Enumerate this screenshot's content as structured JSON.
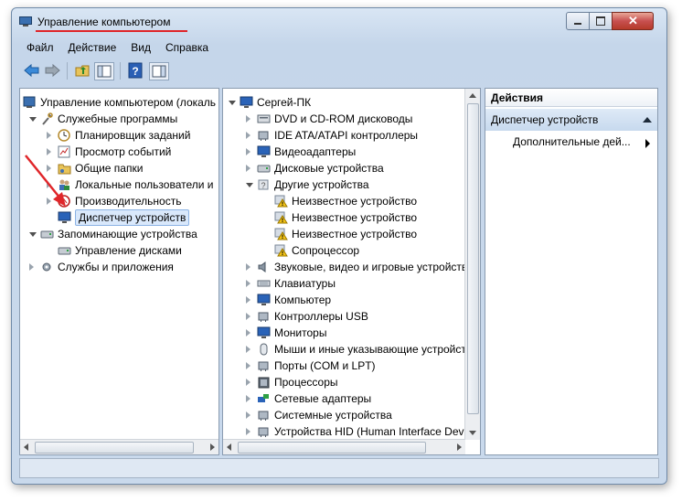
{
  "window": {
    "title": "Управление компьютером"
  },
  "menu": [
    "Файл",
    "Действие",
    "Вид",
    "Справка"
  ],
  "left_tree": [
    {
      "label": "Управление компьютером (локаль",
      "indent": 0,
      "expander": "none",
      "icon": "computer-management-icon"
    },
    {
      "label": "Служебные программы",
      "indent": 1,
      "expander": "down",
      "icon": "tools-icon"
    },
    {
      "label": "Планировщик заданий",
      "indent": 2,
      "expander": "right",
      "icon": "clock-icon"
    },
    {
      "label": "Просмотр событий",
      "indent": 2,
      "expander": "right",
      "icon": "event-viewer-icon"
    },
    {
      "label": "Общие папки",
      "indent": 2,
      "expander": "right",
      "icon": "shared-folder-icon"
    },
    {
      "label": "Локальные пользователи и",
      "indent": 2,
      "expander": "right",
      "icon": "users-icon"
    },
    {
      "label": "Производительность",
      "indent": 2,
      "expander": "right",
      "icon": "performance-icon"
    },
    {
      "label": "Диспетчер устройств",
      "indent": 2,
      "expander": "none",
      "icon": "device-manager-icon",
      "selected": true
    },
    {
      "label": "Запоминающие устройства",
      "indent": 1,
      "expander": "down",
      "icon": "storage-icon"
    },
    {
      "label": "Управление дисками",
      "indent": 2,
      "expander": "none",
      "icon": "disk-icon"
    },
    {
      "label": "Службы и приложения",
      "indent": 1,
      "expander": "right",
      "icon": "services-icon"
    }
  ],
  "device_tree": {
    "root": "Сергей-ПК",
    "items": [
      {
        "label": "DVD и CD-ROM дисководы",
        "indent": 1,
        "expander": "right",
        "icon": "dvd-drive-icon"
      },
      {
        "label": "IDE ATA/ATAPI контроллеры",
        "indent": 1,
        "expander": "right",
        "icon": "ide-controller-icon"
      },
      {
        "label": "Видеоадаптеры",
        "indent": 1,
        "expander": "right",
        "icon": "display-adapter-icon"
      },
      {
        "label": "Дисковые устройства",
        "indent": 1,
        "expander": "right",
        "icon": "disk-drive-icon"
      },
      {
        "label": "Другие устройства",
        "indent": 1,
        "expander": "down",
        "icon": "other-devices-icon"
      },
      {
        "label": "Неизвестное устройство",
        "indent": 2,
        "expander": "none",
        "icon": "warning-device-icon"
      },
      {
        "label": "Неизвестное устройство",
        "indent": 2,
        "expander": "none",
        "icon": "warning-device-icon"
      },
      {
        "label": "Неизвестное устройство",
        "indent": 2,
        "expander": "none",
        "icon": "warning-device-icon"
      },
      {
        "label": "Сопроцессор",
        "indent": 2,
        "expander": "none",
        "icon": "warning-device-icon"
      },
      {
        "label": "Звуковые, видео и игровые устройства",
        "indent": 1,
        "expander": "right",
        "icon": "sound-icon"
      },
      {
        "label": "Клавиатуры",
        "indent": 1,
        "expander": "right",
        "icon": "keyboard-icon"
      },
      {
        "label": "Компьютер",
        "indent": 1,
        "expander": "right",
        "icon": "computer-icon"
      },
      {
        "label": "Контроллеры USB",
        "indent": 1,
        "expander": "right",
        "icon": "usb-icon"
      },
      {
        "label": "Мониторы",
        "indent": 1,
        "expander": "right",
        "icon": "monitor-icon"
      },
      {
        "label": "Мыши и иные указывающие устройства",
        "indent": 1,
        "expander": "right",
        "icon": "mouse-icon"
      },
      {
        "label": "Порты (COM и LPT)",
        "indent": 1,
        "expander": "right",
        "icon": "port-icon"
      },
      {
        "label": "Процессоры",
        "indent": 1,
        "expander": "right",
        "icon": "processor-icon"
      },
      {
        "label": "Сетевые адаптеры",
        "indent": 1,
        "expander": "right",
        "icon": "network-adapter-icon"
      },
      {
        "label": "Системные устройства",
        "indent": 1,
        "expander": "right",
        "icon": "system-devices-icon"
      },
      {
        "label": "Устройства HID (Human Interface Devices)",
        "indent": 1,
        "expander": "right",
        "icon": "hid-icon"
      }
    ]
  },
  "actions": {
    "header": "Действия",
    "section": "Диспетчер устройств",
    "item": "Дополнительные дей..."
  },
  "colors": {
    "selection": "#d9e8fb",
    "annotation": "#e0262a"
  }
}
